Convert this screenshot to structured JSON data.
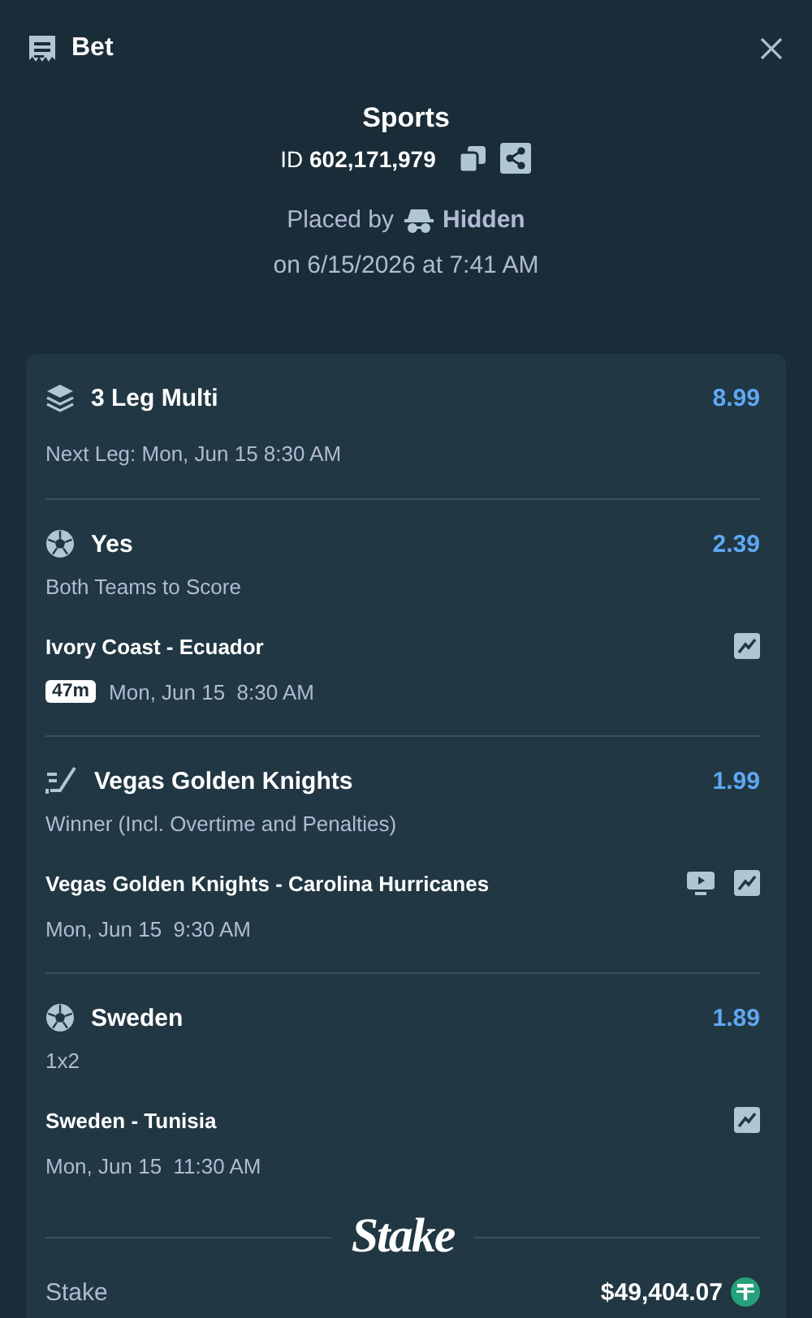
{
  "header": {
    "title": "Bet"
  },
  "summary": {
    "category": "Sports",
    "id": "ID **602,171,979**",
    "placed_by_label": "Placed by",
    "user": "Hidden",
    "placed_on": "on 6/15/2026 at 7:41 AM"
  },
  "multi": {
    "title": "3 Leg Multi",
    "odds": "8.99",
    "next_leg": "Next Leg: Mon, Jun 15 8:30 AM"
  },
  "legs": [
    {
      "kind": "soccer",
      "selection": "Yes",
      "odds": "2.39",
      "market": "Both Teams to Score",
      "match": "Ivory Coast - Ecuador",
      "live_badge": "47m",
      "time": "Mon, Jun 15  8:30 AM",
      "has_stream": false
    },
    {
      "kind": "hockey",
      "selection": "Vegas Golden Knights",
      "odds": "1.99",
      "market": "Winner (Incl. Overtime and Penalties)",
      "match": "Vegas Golden Knights - Carolina Hurricanes",
      "time": "Mon, Jun 15  9:30 AM",
      "has_stream": true
    },
    {
      "kind": "soccer",
      "selection": "Sweden",
      "odds": "1.89",
      "market": "1x2",
      "match": "Sweden - Tunisia",
      "time": "Mon, Jun 15  11:30 AM",
      "has_stream": false
    }
  ],
  "footer": {
    "logo": "Stake",
    "stake_label": "Stake",
    "stake_amount": "$49,404.07"
  }
}
